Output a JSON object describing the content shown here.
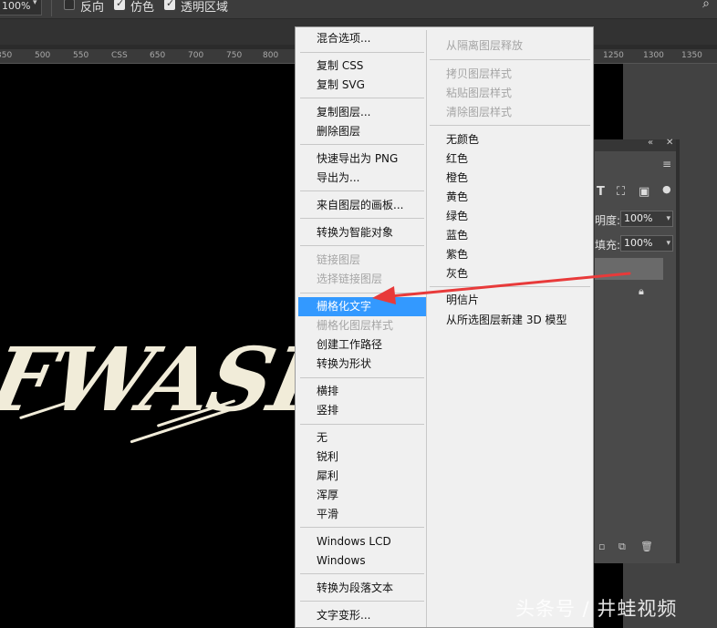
{
  "options_bar": {
    "zoom_value": "100%",
    "checkboxes": [
      {
        "label": "反向",
        "checked": false
      },
      {
        "label": "仿色",
        "checked": true
      },
      {
        "label": "透明区域",
        "checked": true
      }
    ]
  },
  "ruler": {
    "ticks": [
      "350",
      "500",
      "550",
      "CSS",
      "650",
      "700",
      "750",
      "800",
      "1250",
      "1300",
      "1350"
    ]
  },
  "canvas": {
    "artwork_text": "FWASH"
  },
  "layers_panel": {
    "opacity_label": "明度:",
    "opacity_value": "100%",
    "fill_label": "填充:",
    "fill_value": "100%",
    "tool_glyph_text": "T"
  },
  "context_menu": {
    "left_column": [
      {
        "label": "混合选项...",
        "state": "normal"
      },
      {
        "label": "复制 CSS",
        "state": "normal"
      },
      {
        "label": "复制 SVG",
        "state": "normal"
      },
      {
        "label": "复制图层...",
        "state": "normal"
      },
      {
        "label": "删除图层",
        "state": "normal"
      },
      {
        "label": "快速导出为 PNG",
        "state": "normal"
      },
      {
        "label": "导出为...",
        "state": "normal"
      },
      {
        "label": "来自图层的画板...",
        "state": "normal"
      },
      {
        "label": "转换为智能对象",
        "state": "normal"
      },
      {
        "label": "链接图层",
        "state": "disabled"
      },
      {
        "label": "选择链接图层",
        "state": "disabled"
      },
      {
        "label": "栅格化文字",
        "state": "highlighted"
      },
      {
        "label": "栅格化图层样式",
        "state": "disabled"
      },
      {
        "label": "创建工作路径",
        "state": "normal"
      },
      {
        "label": "转换为形状",
        "state": "normal"
      },
      {
        "label": "横排",
        "state": "normal"
      },
      {
        "label": "竖排",
        "state": "normal"
      },
      {
        "label": "无",
        "state": "normal"
      },
      {
        "label": "锐利",
        "state": "normal"
      },
      {
        "label": "犀利",
        "state": "normal"
      },
      {
        "label": "浑厚",
        "state": "normal"
      },
      {
        "label": "平滑",
        "state": "normal"
      },
      {
        "label": "Windows LCD",
        "state": "normal"
      },
      {
        "label": "Windows",
        "state": "normal"
      },
      {
        "label": "转换为段落文本",
        "state": "normal"
      },
      {
        "label": "文字变形...",
        "state": "normal"
      }
    ],
    "right_column": [
      {
        "label": "从隔离图层释放",
        "state": "disabled"
      },
      {
        "label": "拷贝图层样式",
        "state": "disabled"
      },
      {
        "label": "粘贴图层样式",
        "state": "disabled"
      },
      {
        "label": "清除图层样式",
        "state": "disabled"
      },
      {
        "label": "无颜色",
        "state": "normal"
      },
      {
        "label": "红色",
        "state": "normal"
      },
      {
        "label": "橙色",
        "state": "normal"
      },
      {
        "label": "黄色",
        "state": "normal"
      },
      {
        "label": "绿色",
        "state": "normal"
      },
      {
        "label": "蓝色",
        "state": "normal"
      },
      {
        "label": "紫色",
        "state": "normal"
      },
      {
        "label": "灰色",
        "state": "normal"
      },
      {
        "label": "明信片",
        "state": "normal"
      },
      {
        "label": "从所选图层新建 3D 模型",
        "state": "normal"
      }
    ]
  },
  "annotation": {
    "arrow_color": "#e83a3a",
    "target_item": "栅格化文字"
  },
  "watermark": {
    "text": "头条号 / 井蛙视频"
  },
  "colors": {
    "highlight": "#3399ff",
    "menu_bg": "#f0f0f0",
    "disabled_text": "#a5a5a5",
    "canvas": "#000000",
    "artwork": "#f1ecd9"
  }
}
